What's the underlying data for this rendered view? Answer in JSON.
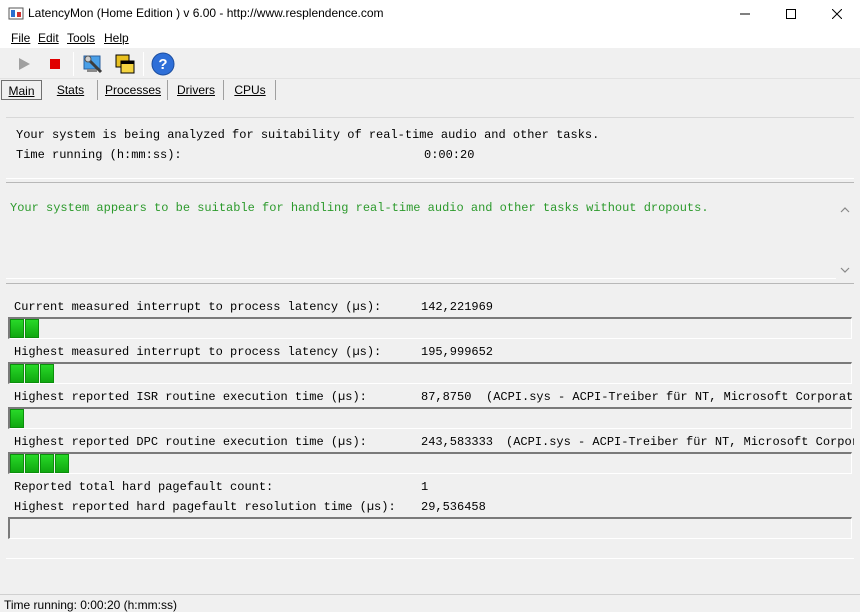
{
  "window": {
    "title": "LatencyMon  (Home Edition )  v 6.00 - http://www.resplendence.com"
  },
  "menu": {
    "file": "File",
    "edit": "Edit",
    "tools": "Tools",
    "help": "Help"
  },
  "toolbar": {
    "icons": [
      "play-icon",
      "stop-icon",
      "wrench-icon",
      "windows-icon",
      "help-icon"
    ]
  },
  "tabs": {
    "main": "Main",
    "stats": "Stats",
    "processes": "Processes",
    "drivers": "Drivers",
    "cpus": "CPUs"
  },
  "summary": {
    "analyzing": "Your system is being analyzed for suitability of real-time audio and other tasks.",
    "time_label": "Time running (h:mm:ss):",
    "time_value": "0:00:20"
  },
  "verdict": "Your system appears to be suitable for handling real-time audio and other tasks without dropouts.",
  "metrics": [
    {
      "label": "Current measured interrupt to process latency (µs):",
      "value": "142,221969",
      "detail": "",
      "bar_segments": 2
    },
    {
      "label": "Highest measured interrupt to process latency (µs):",
      "value": "195,999652",
      "detail": "",
      "bar_segments": 3
    },
    {
      "label": "Highest reported ISR routine execution time (µs):",
      "value": "87,8750",
      "detail": "(ACPI.sys - ACPI-Treiber für NT, Microsoft Corporation)",
      "bar_segments": 1
    },
    {
      "label": "Highest reported DPC routine execution time (µs):",
      "value": "243,583333",
      "detail": "(ACPI.sys - ACPI-Treiber für NT, Microsoft Corporation)",
      "bar_segments": 4
    }
  ],
  "pagefault": {
    "count_label": "Reported total hard pagefault count:",
    "count_value": "1",
    "resolution_label": "Highest reported hard pagefault resolution time (µs):",
    "resolution_value": "29,536458",
    "bar_segments": 0
  },
  "status": "Time running: 0:00:20  (h:mm:ss)",
  "colors": {
    "verdict_green": "#2c9a2c",
    "bar_green": "#18c018",
    "stop_red": "#e00000"
  }
}
